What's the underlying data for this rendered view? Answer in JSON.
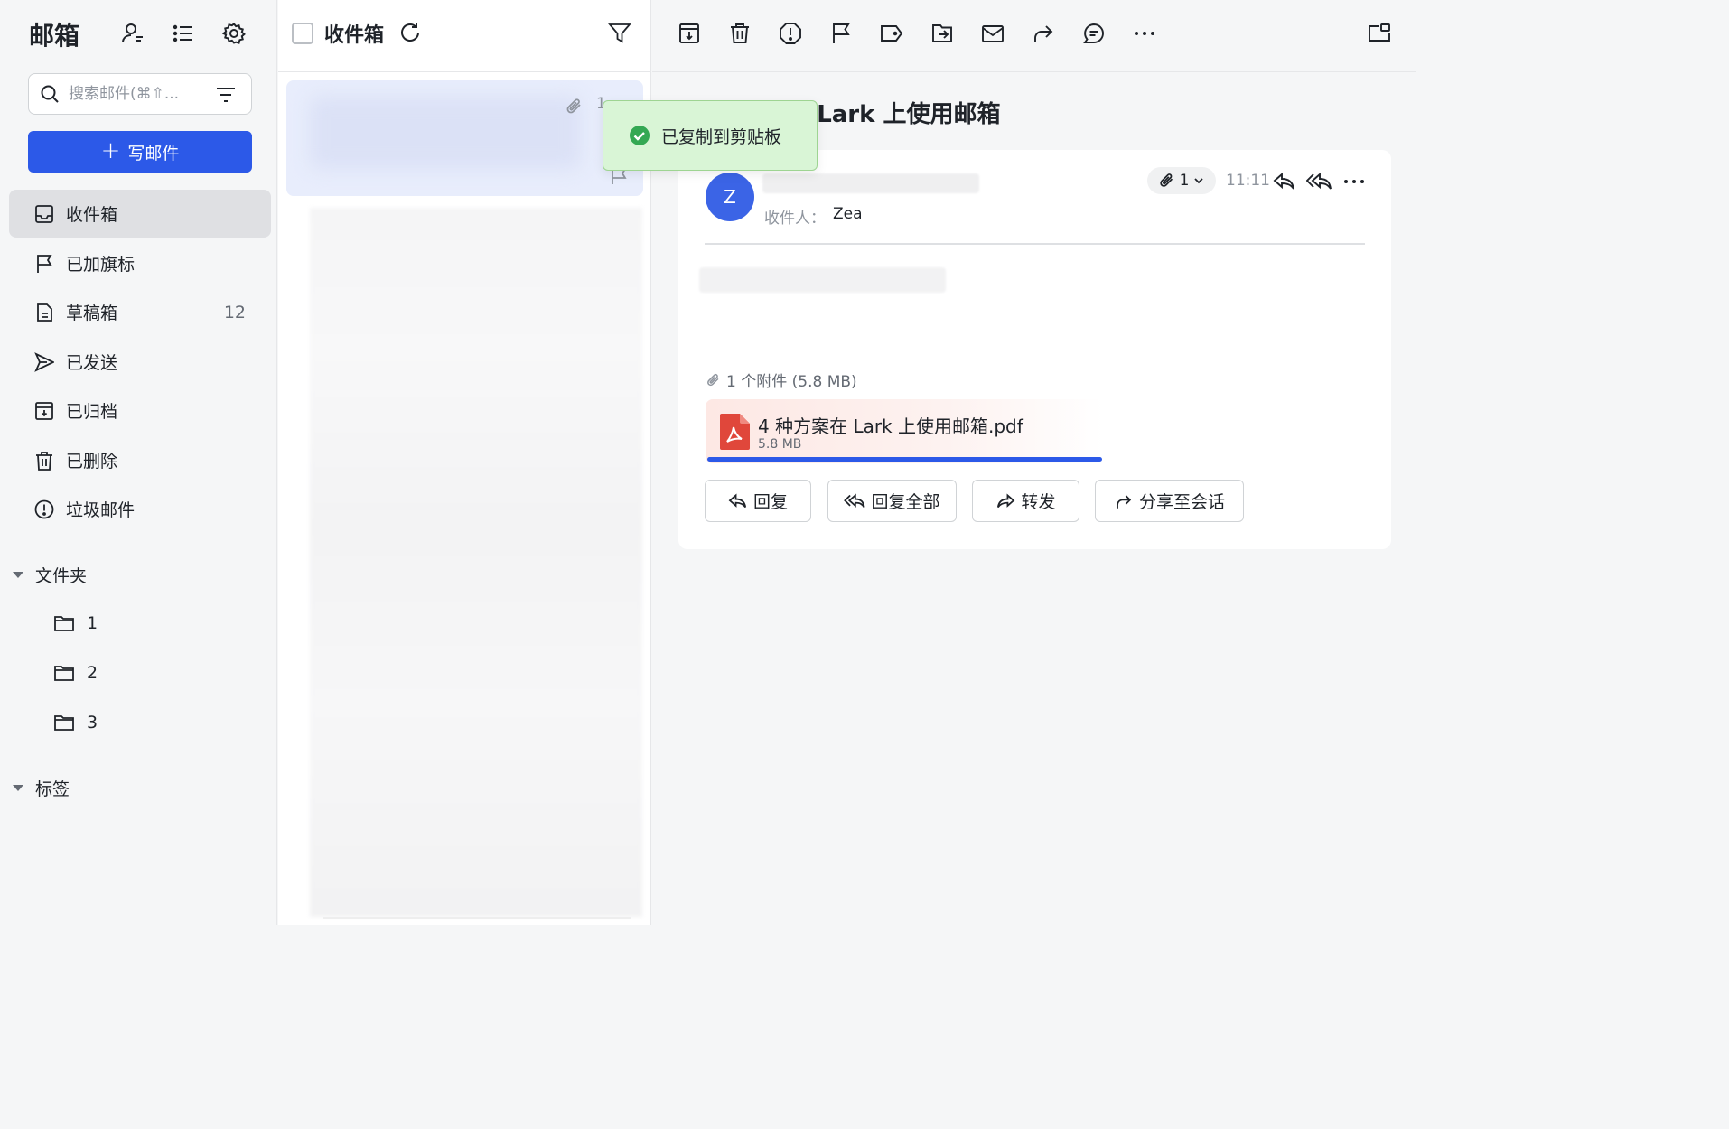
{
  "sidebar": {
    "title": "邮箱",
    "search_placeholder": "搜索邮件(⌘⇧...",
    "compose_label": "写邮件",
    "compose_plus": "+",
    "nav": [
      {
        "label": "收件箱",
        "icon": "inbox-icon"
      },
      {
        "label": "已加旗标",
        "icon": "flag-icon"
      },
      {
        "label": "草稿箱",
        "icon": "draft-icon",
        "count": "12"
      },
      {
        "label": "已发送",
        "icon": "send-icon"
      },
      {
        "label": "已归档",
        "icon": "archive-icon"
      },
      {
        "label": "已删除",
        "icon": "trash-icon"
      },
      {
        "label": "垃圾邮件",
        "icon": "spam-icon"
      }
    ],
    "folders_label": "文件夹",
    "folders": [
      "1",
      "2",
      "3"
    ],
    "labels_label": "标签"
  },
  "list": {
    "title": "收件箱",
    "card_date": "1"
  },
  "toast": {
    "text": "已复制到剪贴板"
  },
  "reader": {
    "subject": "4 种方案在 Lark 上使用邮箱",
    "avatar_letter": "Z",
    "to_label": "收件人：",
    "to_value": "Zea",
    "attach_count": "1",
    "time": "11:11",
    "attachments_summary": "1 个附件 (5.8 MB)",
    "file_name": "4 种方案在 Lark 上使用邮箱.pdf",
    "file_size": "5.8 MB",
    "upload_progress_percent": 100,
    "actions": {
      "reply": "回复",
      "reply_all": "回复全部",
      "forward": "转发",
      "share": "分享至会话"
    }
  },
  "colors": {
    "accent": "#2c59e8",
    "toast_bg": "#d9f5d6",
    "success": "#34a853",
    "pdf_red": "#e0473b"
  }
}
